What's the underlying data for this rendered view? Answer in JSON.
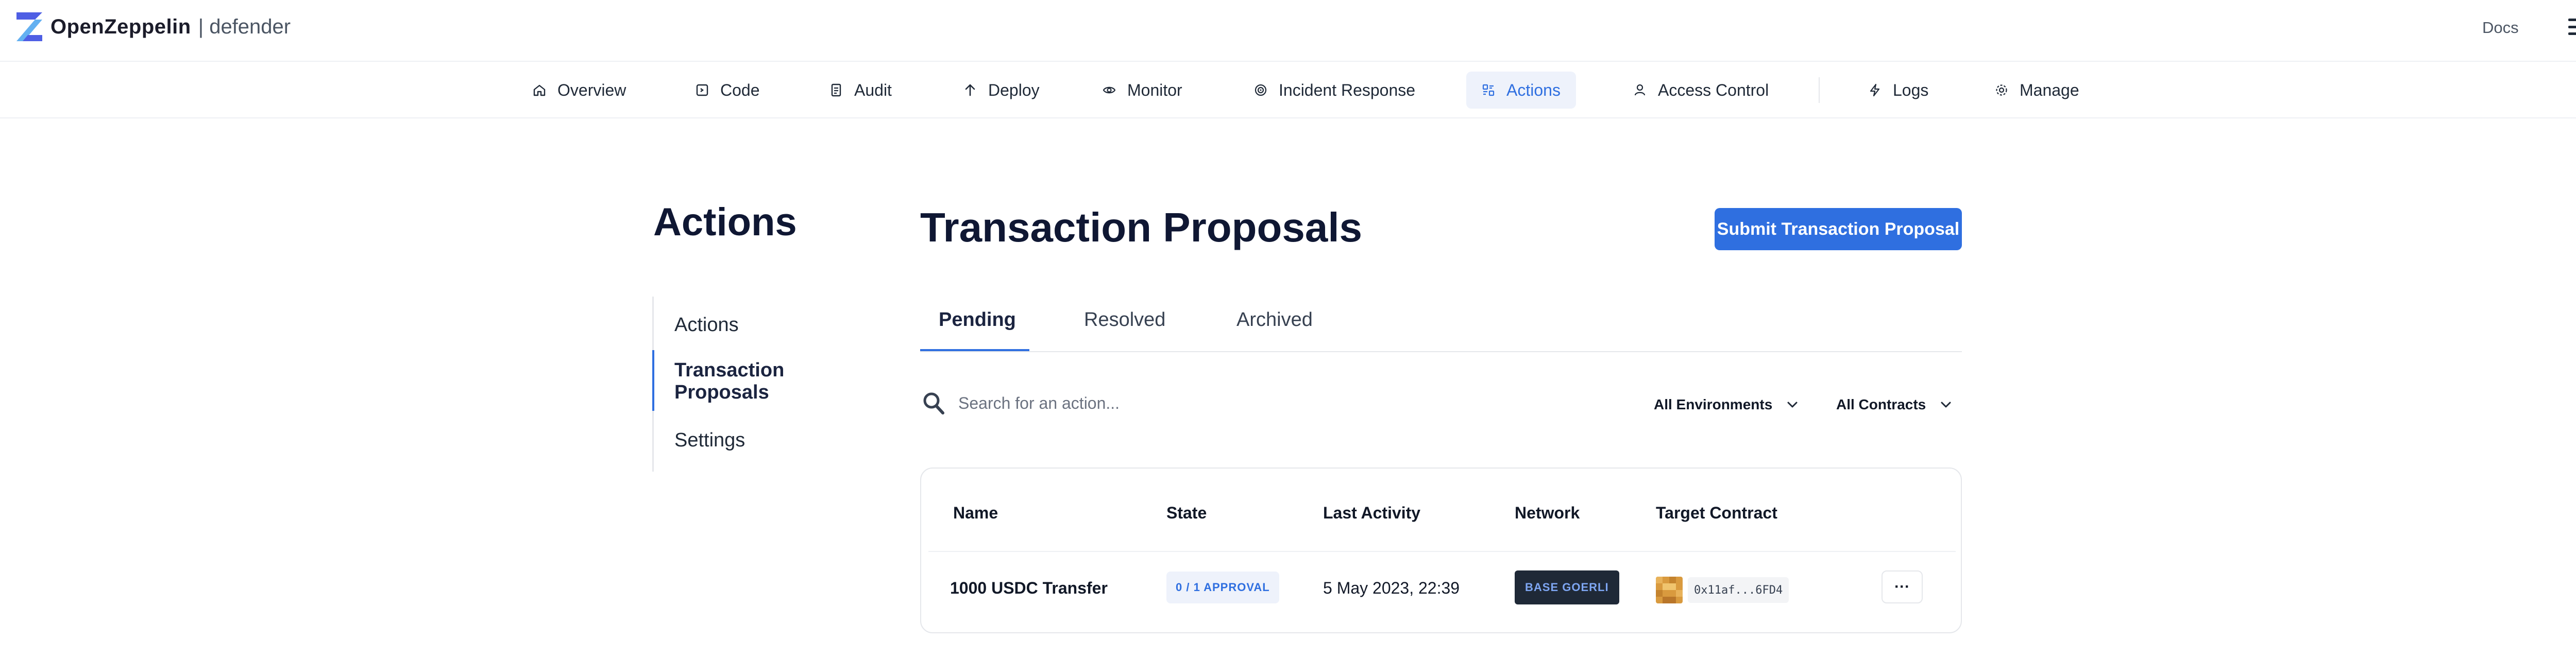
{
  "brand": {
    "name": "OpenZeppelin",
    "product": "| defender",
    "accent": "#2f6fe0"
  },
  "topbar": {
    "docs_label": "Docs"
  },
  "nav": {
    "items": [
      {
        "label": "Overview",
        "icon": "home-icon"
      },
      {
        "label": "Code",
        "icon": "code-icon"
      },
      {
        "label": "Audit",
        "icon": "audit-icon"
      },
      {
        "label": "Deploy",
        "icon": "arrow-up-icon"
      },
      {
        "label": "Monitor",
        "icon": "eye-icon"
      },
      {
        "label": "Incident Response",
        "icon": "target-icon"
      },
      {
        "label": "Actions",
        "icon": "actions-icon",
        "active": true
      },
      {
        "label": "Access Control",
        "icon": "users-icon"
      },
      {
        "label": "Logs",
        "icon": "bolt-icon"
      },
      {
        "label": "Manage",
        "icon": "gear-icon"
      }
    ]
  },
  "sidebar": {
    "title": "Actions",
    "items": [
      {
        "label": "Actions"
      },
      {
        "label": "Transaction Proposals",
        "active": true
      },
      {
        "label": "Settings"
      }
    ]
  },
  "main": {
    "title": "Transaction Proposals",
    "submit_label": "Submit Transaction Proposal",
    "tabs": [
      {
        "label": "Pending",
        "active": true
      },
      {
        "label": "Resolved"
      },
      {
        "label": "Archived"
      }
    ],
    "search": {
      "placeholder": "Search for an action...",
      "value": ""
    },
    "filters": {
      "environments": "All Environments",
      "contracts": "All Contracts"
    },
    "table": {
      "headers": [
        "Name",
        "State",
        "Last Activity",
        "Network",
        "Target Contract"
      ],
      "rows": [
        {
          "name": "1000 USDC Transfer",
          "state": "0 / 1 APPROVAL",
          "last_activity": "5 May 2023, 22:39",
          "network": "BASE GOERLI",
          "target_contract": "0x11af...6FD4",
          "more_label": "···"
        }
      ]
    }
  }
}
